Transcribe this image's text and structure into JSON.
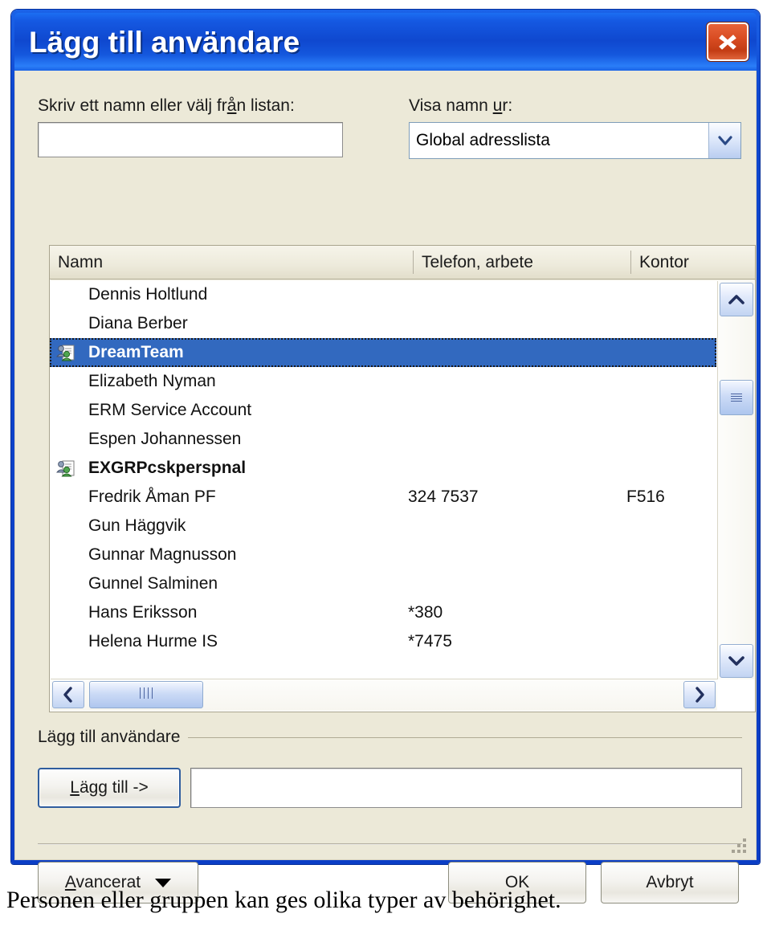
{
  "window": {
    "title": "Lägg till användare",
    "close_label": "Stäng"
  },
  "form": {
    "name_label_prefix": "Skriv ett namn eller välj fr",
    "name_label_accel": "å",
    "name_label_suffix": "n listan:",
    "name_value": "",
    "source_label_prefix": "Visa namn ",
    "source_label_accel": "u",
    "source_label_suffix": "r:",
    "source_value": "Global adresslista"
  },
  "list": {
    "columns": [
      "Namn",
      "Telefon, arbete",
      "Kontor"
    ],
    "rows": [
      {
        "name": "Dennis Holtlund",
        "phone": "",
        "office": "",
        "group": false,
        "selected": false
      },
      {
        "name": "Diana Berber",
        "phone": "",
        "office": "",
        "group": false,
        "selected": false
      },
      {
        "name": "DreamTeam",
        "phone": "",
        "office": "",
        "group": true,
        "selected": true
      },
      {
        "name": "Elizabeth Nyman",
        "phone": "",
        "office": "",
        "group": false,
        "selected": false
      },
      {
        "name": "ERM Service Account",
        "phone": "",
        "office": "",
        "group": false,
        "selected": false
      },
      {
        "name": "Espen Johannessen",
        "phone": "",
        "office": "",
        "group": false,
        "selected": false
      },
      {
        "name": "EXGRPcskperspnal",
        "phone": "",
        "office": "",
        "group": true,
        "selected": false
      },
      {
        "name": "Fredrik Åman PF",
        "phone": "324 7537",
        "office": "F516",
        "group": false,
        "selected": false
      },
      {
        "name": "Gun Häggvik",
        "phone": "",
        "office": "",
        "group": false,
        "selected": false
      },
      {
        "name": "Gunnar Magnusson",
        "phone": "",
        "office": "",
        "group": false,
        "selected": false
      },
      {
        "name": "Gunnel Salminen",
        "phone": "",
        "office": "",
        "group": false,
        "selected": false
      },
      {
        "name": "Hans Eriksson",
        "phone": "*380",
        "office": "",
        "group": false,
        "selected": false
      },
      {
        "name": "Helena Hurme IS",
        "phone": "*7475",
        "office": "",
        "group": false,
        "selected": false
      }
    ]
  },
  "groupbox": {
    "legend": "Lägg till användare",
    "add_button_accel": "L",
    "add_button_rest": "ägg till ->",
    "recipient_value": ""
  },
  "footer": {
    "advanced_accel": "A",
    "advanced_rest": "vancerat",
    "ok_label": "OK",
    "cancel_label": "Avbryt"
  },
  "caption": "Personen eller gruppen kan ges olika typer av behörighet.",
  "colors": {
    "title_blue": "#0f48cf",
    "selection_blue": "#3269bf",
    "dialog_face": "#ece9d8",
    "close_red": "#d94c22"
  }
}
